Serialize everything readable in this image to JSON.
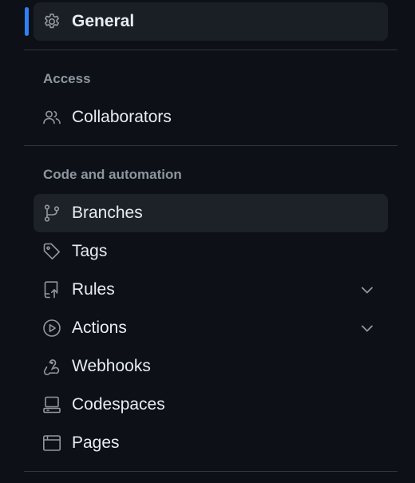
{
  "sidebar": {
    "general": {
      "label": "General",
      "icon": "gear-icon"
    },
    "sections": [
      {
        "heading": "Access"
      },
      {
        "heading": "Code and automation"
      }
    ],
    "items": [
      {
        "label": "Collaborators",
        "icon": "people-icon"
      },
      {
        "label": "Branches",
        "icon": "git-branch-icon"
      },
      {
        "label": "Tags",
        "icon": "tag-icon"
      },
      {
        "label": "Rules",
        "icon": "repo-push-icon",
        "expandable": true
      },
      {
        "label": "Actions",
        "icon": "play-icon",
        "expandable": true
      },
      {
        "label": "Webhooks",
        "icon": "webhook-icon"
      },
      {
        "label": "Codespaces",
        "icon": "codespaces-icon"
      },
      {
        "label": "Pages",
        "icon": "browser-icon"
      }
    ]
  },
  "colors": {
    "background": "#0d1117",
    "text": "#e6edf3",
    "muted": "#8d96a0",
    "accent": "#2f81f7",
    "selected_bg": "#1a1f26",
    "divider": "#30363d"
  }
}
